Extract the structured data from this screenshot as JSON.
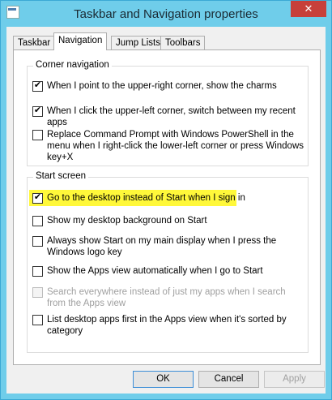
{
  "window": {
    "title": "Taskbar and Navigation properties",
    "close_glyph": "✕",
    "app_icon": "taskbar-properties-icon"
  },
  "tabs": [
    {
      "label": "Taskbar",
      "active": false
    },
    {
      "label": "Navigation",
      "active": true
    },
    {
      "label": "Jump Lists",
      "active": false
    },
    {
      "label": "Toolbars",
      "active": false
    }
  ],
  "corner_navigation": {
    "title": "Corner navigation",
    "options": [
      {
        "label": "When I point to the upper-right corner, show the charms",
        "checked": true
      },
      {
        "label": "When I click the upper-left corner, switch between my recent apps",
        "checked": true
      },
      {
        "label": "Replace Command Prompt with Windows PowerShell in the menu when I right-click the lower-left corner or press Windows key+X",
        "checked": false
      }
    ]
  },
  "start_screen": {
    "title": "Start screen",
    "options": [
      {
        "label": "Go to the desktop instead of Start when I sign in",
        "checked": true,
        "highlighted": true
      },
      {
        "label": "Show my desktop background on Start",
        "checked": false
      },
      {
        "label": "Always show Start on my main display when I press the Windows logo key",
        "checked": false
      },
      {
        "label": "Show the Apps view automatically when I go to Start",
        "checked": false
      },
      {
        "label": "Search everywhere instead of just my apps when I search from the Apps view",
        "checked": false,
        "disabled": true
      },
      {
        "label": "List desktop apps first in the Apps view when it's sorted by category",
        "checked": false
      }
    ]
  },
  "buttons": {
    "ok": "OK",
    "cancel": "Cancel",
    "apply": "Apply"
  },
  "colors": {
    "title_bar": "#6fcdea",
    "close_button": "#c7403a",
    "highlight": "#fff83a"
  }
}
